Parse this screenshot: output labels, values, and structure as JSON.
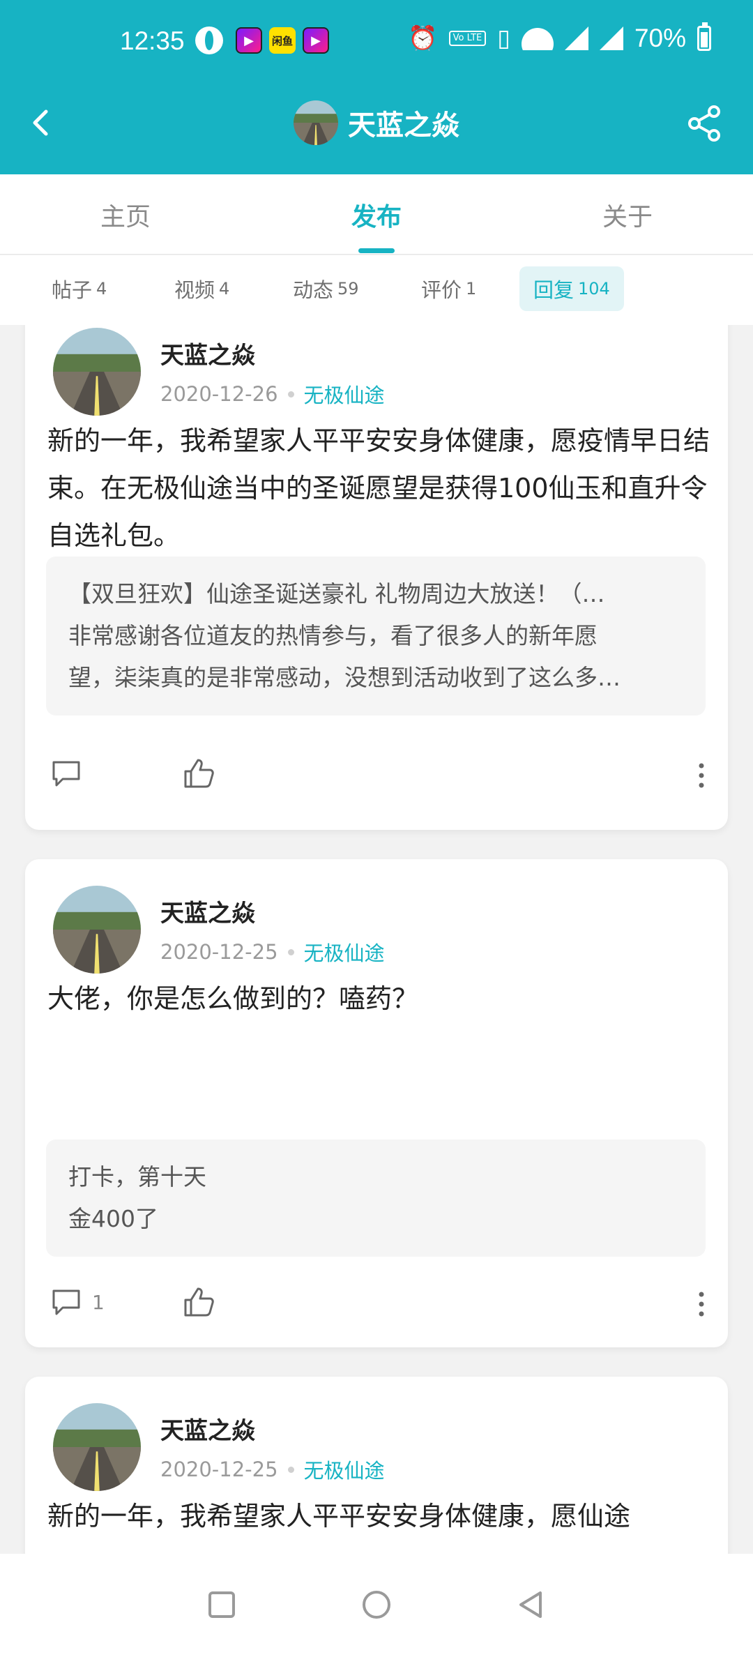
{
  "status_bar": {
    "time": "12:35",
    "app_icon_yellow_text": "闲鱼",
    "lte_badge": "Vo LTE",
    "battery": "70%"
  },
  "titlebar": {
    "back_icon": "chevron-left-icon",
    "title": "天蓝之焱",
    "share_icon": "share-icon"
  },
  "tabs": [
    {
      "label": "主页"
    },
    {
      "label": "发布",
      "active": true
    },
    {
      "label": "关于"
    }
  ],
  "filters": [
    {
      "label": "帖子",
      "count": "4"
    },
    {
      "label": "视频",
      "count": "4"
    },
    {
      "label": "动态",
      "count": "59"
    },
    {
      "label": "评价",
      "count": "1"
    },
    {
      "label": "回复",
      "count": "104",
      "active": true
    }
  ],
  "posts": [
    {
      "author": "天蓝之焱",
      "date": "2020-12-26",
      "forum": "无极仙途",
      "content": "新的一年，我希望家人平平安安身体健康，愿疫情早日结束。在无极仙途当中的圣诞愿望是获得100仙玉和直升令自选礼包。",
      "quote": [
        "【双旦狂欢】仙途圣诞送豪礼 礼物周边大放送！（…",
        "非常感谢各位道友的热情参与，看了很多人的新年愿",
        "望，柒柒真的是非常感动，没想到活动收到了这么多…"
      ],
      "comment_count": ""
    },
    {
      "author": "天蓝之焱",
      "date": "2020-12-25",
      "forum": "无极仙途",
      "content": "大佬，你是怎么做到的？嗑药？",
      "quote": [
        "打卡，第十天",
        "金400了"
      ],
      "comment_count": "1"
    },
    {
      "author": "天蓝之焱",
      "date": "2020-12-25",
      "forum": "无极仙途",
      "content": "新的一年，我希望家人平平安安身体健康，愿仙途"
    }
  ],
  "colors": {
    "accent": "#17b3c3",
    "background": "#f2f2f2"
  }
}
